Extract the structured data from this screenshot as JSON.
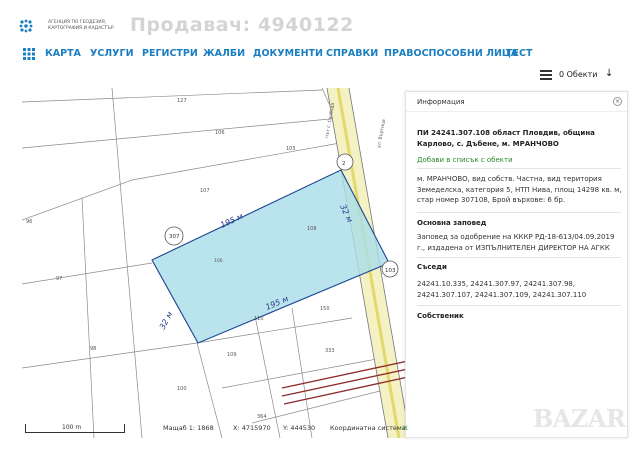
{
  "header": {
    "agency": "АГЕНЦИЯ ПО ГЕОДЕЗИЯ, КАРТОГРАФИЯ И КАДАСТЪР",
    "watermark": "Продавач: 4940122"
  },
  "nav": {
    "items": [
      "КАРТА",
      "УСЛУГИ",
      "РЕГИСТРИ",
      "ЖАЛБИ",
      "ДОКУМЕНТИ",
      "СПРАВКИ",
      "ПРАВОСПОСОБНИ ЛИЦА",
      "ТЕСТ"
    ]
  },
  "toolbar": {
    "objects_label": "0 Обекти"
  },
  "map": {
    "parcel_labels": [
      "127",
      "106",
      "107",
      "105",
      "108",
      "96",
      "97",
      "98",
      "110",
      "109",
      "100",
      "150",
      "333",
      "364",
      "307"
    ],
    "road_label": "път с. Свобода",
    "road_label_2": "ул. Въртица",
    "markers": [
      "307",
      "2",
      "103"
    ],
    "dims": [
      "195 м",
      "195 м",
      "32 м",
      "32 м"
    ]
  },
  "panel": {
    "title": "Информация",
    "close": "×",
    "heading": "ПИ 24241.307.108 област Пловдив, община Карлово, с. Дъбене, м. МРАНЧОВО",
    "add_link": "Добави в списък с обекти",
    "description": "м. МРАНЧОВО, вид собств. Частна, вид територия Земеделска, категория 5, НТП Нива, площ 14298 кв. м, стар номер 307108, Брой върхове: 6 бр.",
    "order_title": "Основна заповед",
    "order_text": "Заповед за одобрение на КККР РД-18-613/04.09.2019 г., издадена от ИЗПЪЛНИТЕЛЕН ДИРЕКТОР НА АГКК",
    "neighbors_title": "Съседи",
    "neighbors_text": "24241.10.335, 24241.307.97, 24241.307.98, 24241.307.107, 24241.307.109, 24241.307.110",
    "owners_title": "Собственик"
  },
  "status": {
    "scale_label": "100 m",
    "scale": "Мащаб 1:  1868",
    "x": "X:  4715970",
    "y": "Y:  444530",
    "crs": "Координатна система:",
    "crs_value": "К"
  },
  "watermark_bottom": "BAZAR"
}
